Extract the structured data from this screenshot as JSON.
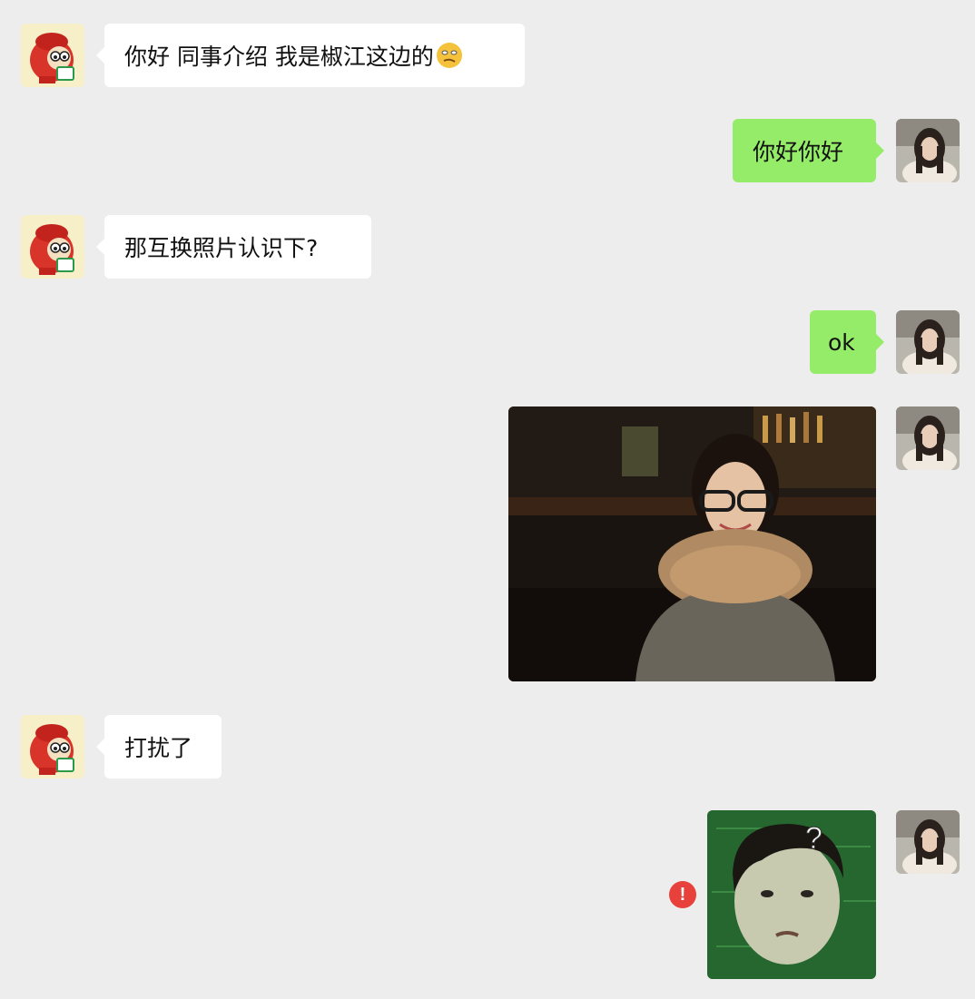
{
  "messages": [
    {
      "side": "in",
      "type": "text",
      "text": "你好 同事介绍 我是椒江这边的",
      "emoji": "thinking-face-emoji"
    },
    {
      "side": "out",
      "type": "text",
      "text": "你好你好"
    },
    {
      "side": "in",
      "type": "text",
      "text": "那互换照片认识下?"
    },
    {
      "side": "out",
      "type": "text",
      "text": "ok"
    },
    {
      "side": "out",
      "type": "image",
      "image": "photo-woman-glasses-fur-coat"
    },
    {
      "side": "in",
      "type": "text",
      "text": "打扰了"
    },
    {
      "side": "out",
      "type": "image",
      "image": "photo-child-question-mark",
      "status": "send-failed",
      "status_symbol": "!"
    }
  ],
  "avatars": {
    "contact": "cartoon-avatar-icon",
    "self": "user-photo-avatar"
  },
  "colors": {
    "background": "#ededed",
    "incoming_bubble": "#ffffff",
    "outgoing_bubble": "#95ec69",
    "error": "#e8413c"
  }
}
